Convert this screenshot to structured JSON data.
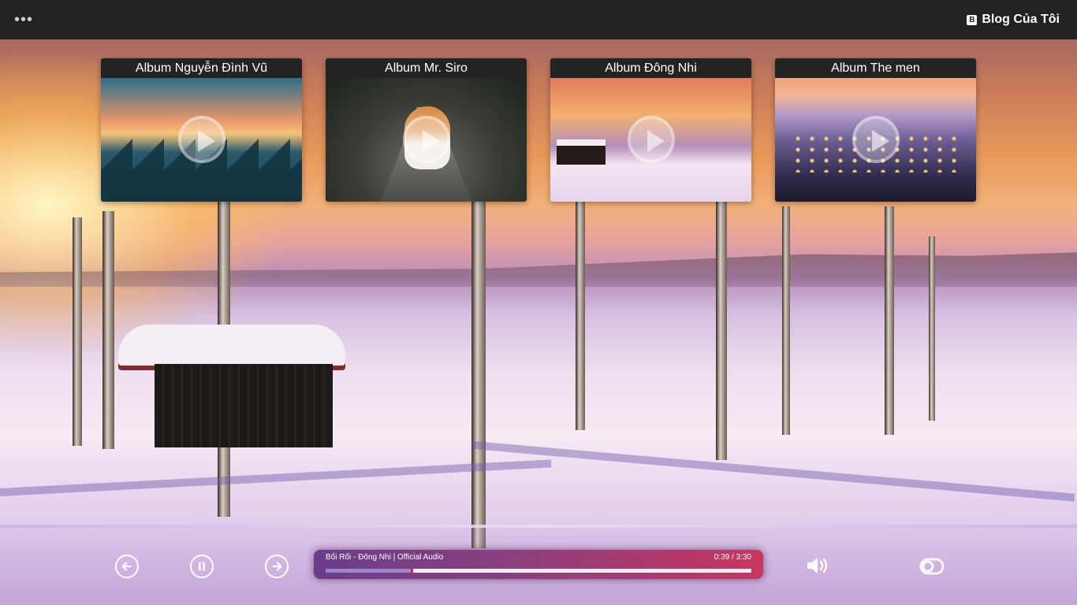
{
  "topbar": {
    "menu_icon": "more-horizontal-icon",
    "brand_icon": "blogger-icon",
    "brand_icon_letter": "B",
    "brand_label": "Blog Của Tôi"
  },
  "albums": [
    {
      "title": "Album Nguyễn Đình Vũ",
      "icon": "play-icon"
    },
    {
      "title": "Album Mr. Siro",
      "icon": "play-icon"
    },
    {
      "title": "Album Đông Nhi",
      "icon": "play-icon"
    },
    {
      "title": "Album The men",
      "icon": "play-icon"
    }
  ],
  "player": {
    "prev_icon": "arrow-left-circle-icon",
    "pause_icon": "pause-circle-icon",
    "next_icon": "arrow-right-circle-icon",
    "track_title": "Bối Rối - Đông Nhi | Official Audio",
    "time_display": "0:39 / 3:30",
    "progress": 0.2,
    "volume_icon": "volume-up-icon",
    "toggle_icon": "toggle-icon",
    "accent_colors": {
      "start": "#6a3d8a",
      "end": "#c8365e",
      "progress_fill": "#9e87c8"
    }
  }
}
